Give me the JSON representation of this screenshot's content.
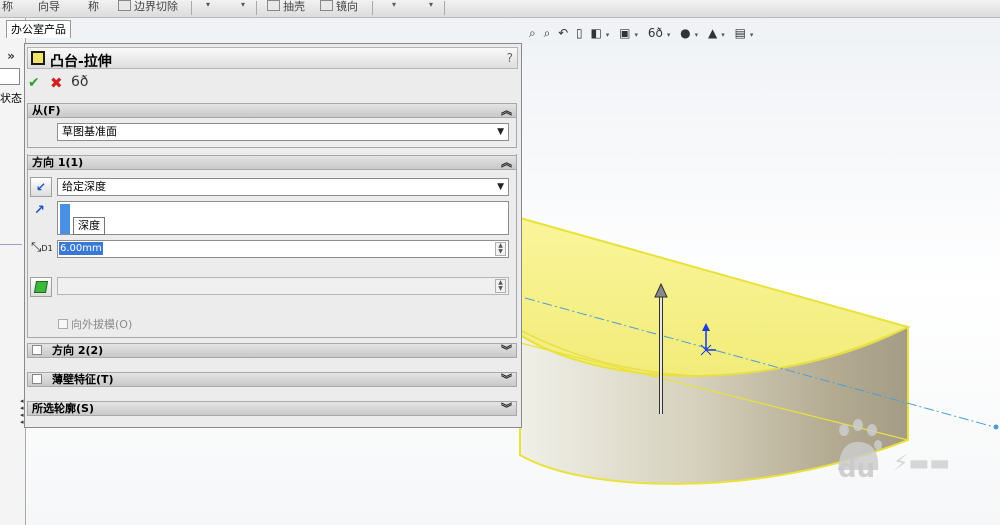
{
  "toolbar": {
    "items": [
      {
        "label": "称",
        "icon": "toolbar-icon"
      },
      {
        "label": "向导",
        "icon": "toolbar-icon"
      },
      {
        "label": "称",
        "icon": "toolbar-icon"
      },
      {
        "label": "边界切除",
        "icon": "boundary-cut-icon"
      },
      {
        "label": "抽壳",
        "icon": "shell-icon"
      },
      {
        "label": "镜向",
        "icon": "mirror-icon"
      }
    ]
  },
  "left_strip": {
    "tab_label": "办公室产品",
    "expand_symbol": "»",
    "status_text": "状态"
  },
  "property_manager": {
    "title": "凸台-拉伸",
    "help_symbol": "?",
    "icons": {
      "ok": "check-icon",
      "cancel": "x-icon",
      "preview": "glasses-icon"
    },
    "colors": {
      "ok": "#2ea02e",
      "cancel": "#d02020",
      "selection": "#3a78d6",
      "feature_yellow": "#f3e36a"
    },
    "groups": {
      "from": {
        "title": "从(F)",
        "chevron": "⌃",
        "value": "草图基准面"
      },
      "direction1": {
        "title": "方向 1(1)",
        "chevron": "⌃",
        "end_condition": "给定深度",
        "tooltip": "深度",
        "depth_value": "6.00mm",
        "draft_label": "向外拔模(O)"
      },
      "direction2": {
        "title": "方向 2(2)",
        "chevron": "⌄"
      },
      "thin_feature": {
        "title": "薄壁特征(T)",
        "chevron": "⌄"
      },
      "selected_contours": {
        "title": "所选轮廓(S)",
        "chevron": "⌄"
      }
    }
  },
  "view_toolbar": {
    "icons": [
      "zoom-to-fit-icon",
      "zoom-area-icon",
      "previous-view-icon",
      "section-view-icon",
      "view-orientation-icon",
      "display-style-icon",
      "hide-show-icon",
      "appearance-icon",
      "scene-icon",
      "view-settings-icon"
    ]
  },
  "model": {
    "colors": {
      "highlight": "#f5ef5a",
      "edge": "#e9e23a",
      "body": "#d9d3b7",
      "axis": "#4c9ed8"
    }
  },
  "watermark": {
    "text": "du"
  }
}
